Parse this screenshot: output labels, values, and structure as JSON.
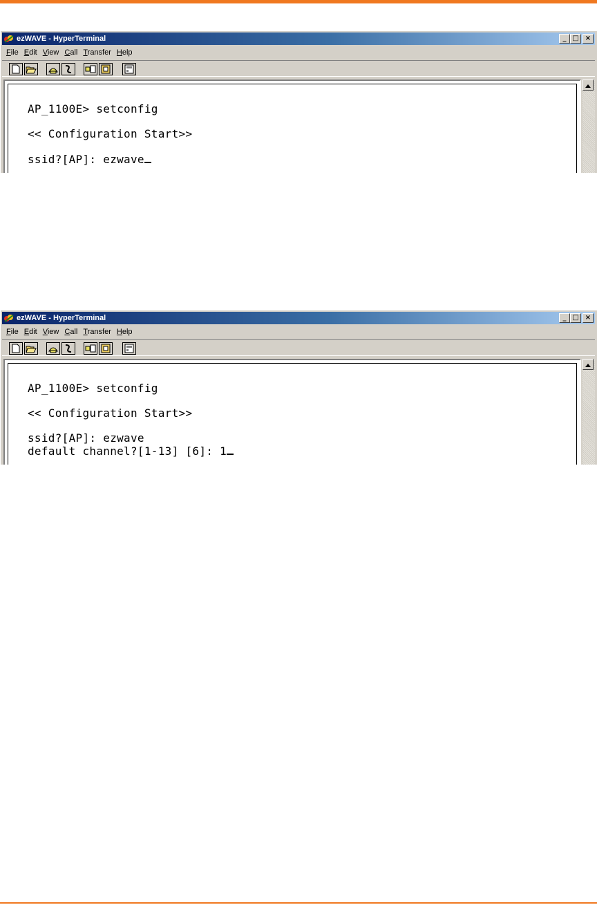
{
  "windows": [
    {
      "title": "ezWAVE - HyperTerminal",
      "menu": [
        "File",
        "Edit",
        "View",
        "Call",
        "Transfer",
        "Help"
      ],
      "caption_buttons": [
        "_",
        "□",
        "×"
      ],
      "terminal_lines": [
        "AP_1100E> setconfig",
        "<< Configuration Start>>",
        "ssid?[AP]: ezwave"
      ]
    },
    {
      "title": "ezWAVE - HyperTerminal",
      "menu": [
        "File",
        "Edit",
        "View",
        "Call",
        "Transfer",
        "Help"
      ],
      "caption_buttons": [
        "_",
        "□",
        "×"
      ],
      "terminal_lines": [
        "AP_1100E> setconfig",
        "<< Configuration Start>>",
        "ssid?[AP]: ezwave",
        "default channel?[1-13] [6]: 1"
      ]
    }
  ],
  "toolbar_icons": [
    "new-icon",
    "open-icon",
    "call-icon",
    "disconnect-icon",
    "send-icon",
    "receive-icon",
    "properties-icon"
  ],
  "colors": {
    "accent_rule": "#f07820",
    "title_bar": "#0a246a"
  }
}
